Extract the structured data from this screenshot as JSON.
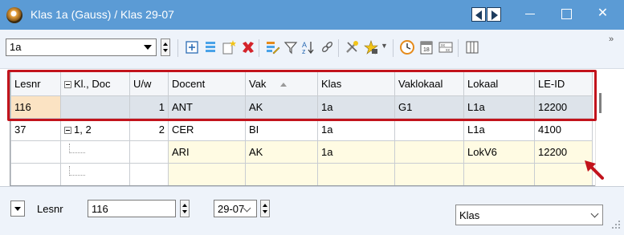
{
  "window": {
    "title": "Klas 1a (Gauss) / Klas  29-07",
    "titlebar_color": "#5b9bd5",
    "controls": [
      "minimize",
      "maximize",
      "close"
    ]
  },
  "toolbar": {
    "class_combo_value": "1a",
    "icons": [
      "expand-icon",
      "list-icon",
      "new-icon",
      "delete-icon",
      "edit-icon",
      "filter-icon",
      "sort-icon",
      "link-icon",
      "tools-icon",
      "wizard-icon",
      "clock-icon",
      "calendar-icon",
      "grid-icon",
      "columns-icon"
    ],
    "more_glyph": "»"
  },
  "grid": {
    "columns": [
      {
        "label": "Lesnr"
      },
      {
        "label": "Kl., Doc"
      },
      {
        "label": "U/w"
      },
      {
        "label": "Docent"
      },
      {
        "label": "Vak"
      },
      {
        "label": "Klas"
      },
      {
        "label": "Vaklokaal"
      },
      {
        "label": "Lokaal"
      },
      {
        "label": "LE-ID"
      }
    ],
    "rows": [
      {
        "lesnr": "116",
        "kl_doc": "",
        "uw": "1",
        "docent": "ANT",
        "vak": "AK",
        "klas": "1a",
        "vaklokaal": "G1",
        "lokaal": "L1a",
        "le_id": "12200"
      },
      {
        "lesnr": "37",
        "kl_doc": "1, 2",
        "uw": "2",
        "docent": "CER",
        "vak": "BI",
        "klas": "1a",
        "vaklokaal": "",
        "lokaal": "L1a",
        "le_id": "4100"
      },
      {
        "lesnr": "",
        "kl_doc": "",
        "uw": "",
        "docent": "ARI",
        "vak": "AK",
        "klas": "1a",
        "vaklokaal": "",
        "lokaal": "LokV6",
        "le_id": "12200"
      },
      {
        "lesnr": "",
        "kl_doc": "",
        "uw": "",
        "docent": "",
        "vak": "",
        "klas": "",
        "vaklokaal": "",
        "lokaal": "",
        "le_id": ""
      }
    ],
    "highlight_color": "#c2131c"
  },
  "statusbar": {
    "field_label": "Lesnr",
    "lesnr_value": "116",
    "date_value": "29-07",
    "view_selector_value": "Klas"
  }
}
